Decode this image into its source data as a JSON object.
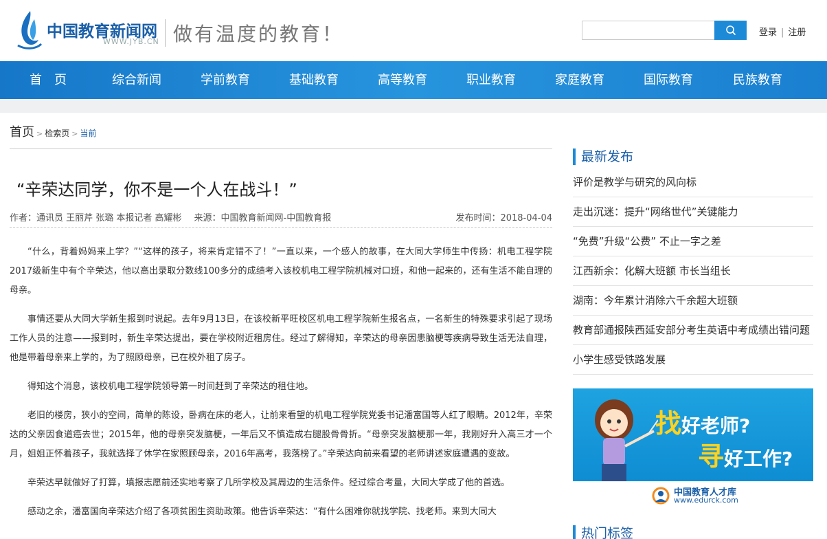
{
  "header": {
    "site_name": "中国教育新闻网",
    "site_url": "WWW.JYB.CN",
    "slogan": "做有温度的教育！",
    "search": {
      "placeholder": "",
      "value": ""
    },
    "login_label": "登录",
    "auth_sep": "|",
    "register_label": "注册"
  },
  "nav": {
    "items": [
      {
        "label": "首　页"
      },
      {
        "label": "综合新闻"
      },
      {
        "label": "学前教育"
      },
      {
        "label": "基础教育"
      },
      {
        "label": "高等教育"
      },
      {
        "label": "职业教育"
      },
      {
        "label": "家庭教育"
      },
      {
        "label": "国际教育"
      },
      {
        "label": "民族教育"
      }
    ]
  },
  "breadcrumb": {
    "home": "首页",
    "sep": ">",
    "search_page": "检索页",
    "current": "当前"
  },
  "article": {
    "title": "“辛荣达同学，你不是一个人在战斗！”",
    "authors": "作者：通讯员 王丽芹 张璐 本报记者 高耀彬",
    "source": "来源：中国教育新闻网-中国教育报",
    "date": "发布时间：2018-04-04",
    "paragraphs": [
      "“什么，背着妈妈来上学？”“这样的孩子，将来肯定错不了！”一直以来，一个感人的故事，在大同大学师生中传扬：机电工程学院2017级新生中有个辛荣达，他以高出录取分数线100多分的成绩考入该校机电工程学院机械对口班，和他一起来的，还有生活不能自理的母亲。",
      "事情还要从大同大学新生报到时说起。去年9月13日，在该校新平旺校区机电工程学院新生报名点，一名新生的特殊要求引起了现场工作人员的注意——报到时，新生辛荣达提出，要在学校附近租房住。经过了解得知，辛荣达的母亲因患脑梗等疾病导致生活无法自理，他是带着母亲来上学的，为了照顾母亲，已在校外租了房子。",
      "得知这个消息，该校机电工程学院领导第一时间赶到了辛荣达的租住地。",
      "老旧的楼房，狭小的空间，简单的陈设，卧病在床的老人，让前来看望的机电工程学院党委书记潘富国等人红了眼睛。2012年，辛荣达的父亲因食道癌去世；2015年，他的母亲突发脑梗，一年后又不慎造成右腿股骨骨折。“母亲突发脑梗那一年，我刚好升入高三才一个月，姐姐正怀着孩子，我就选择了休学在家照顾母亲，2016年高考，我落榜了。”辛荣达向前来看望的老师讲述家庭遭遇的变故。",
      "辛荣达早就做好了打算，填报志愿前还实地考察了几所学校及其周边的生活条件。经过综合考量，大同大学成了他的首选。",
      "感动之余，潘富国向辛荣达介绍了各项贫困生资助政策。他告诉辛荣达：“有什么困难你就找学院、找老师。来到大同大"
    ]
  },
  "sidebar": {
    "latest_title": "最新发布",
    "latest": [
      "评价是教学与研究的风向标",
      "走出沉迷：提升“网络世代”关键能力",
      "“免费”升级“公费” 不止一字之差",
      "江西新余：化解大班额 市长当组长",
      "湖南：今年累计消除六千余超大班额",
      "教育部通报陕西延安部分考生英语中考成绩出错问题",
      "小学生感受铁路发展"
    ],
    "ad": {
      "big1": "找",
      "line1": "好老师?",
      "big2": "寻",
      "line2": "好工作?",
      "brand": "中国教育人才库",
      "url": "www.edurck.com"
    },
    "hot_title": "热门标签"
  },
  "colors": {
    "brand_blue": "#1a5fa8",
    "nav_blue": "#2794de",
    "accent_yellow": "#ffd21f"
  }
}
